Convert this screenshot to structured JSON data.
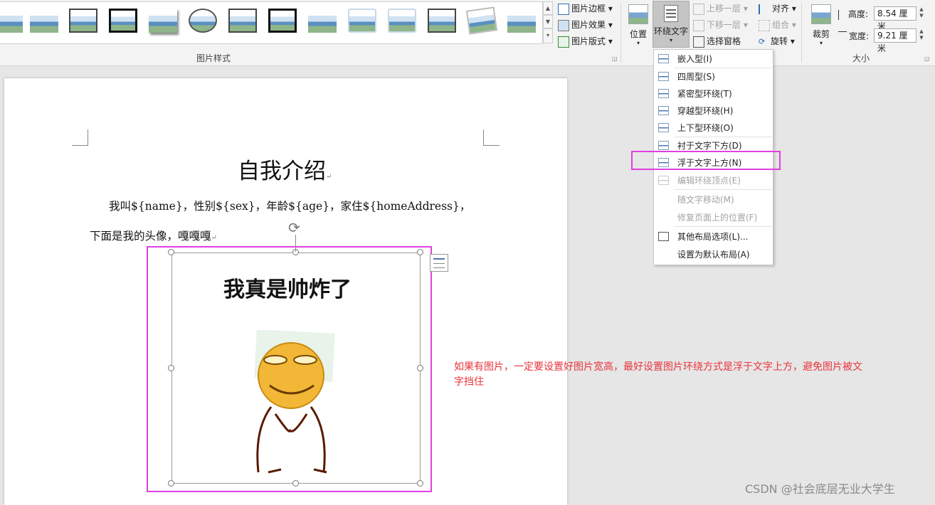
{
  "ribbon": {
    "picture_styles_group": "图片样式",
    "picture_border": "图片边框",
    "picture_effects": "图片效果",
    "picture_layout": "图片版式",
    "position": "位置",
    "wrap_text": "环绕文字",
    "bring_forward": "上移一层",
    "send_backward": "下移一层",
    "selection_pane": "选择窗格",
    "align": "对齐",
    "group": "组合",
    "rotate": "旋转",
    "crop": "裁剪",
    "height_label": "高度:",
    "height_value": "8.54 厘米",
    "width_label": "宽度:",
    "width_value": "9.21 厘米",
    "size_group": "大小"
  },
  "wrap_menu": {
    "items": [
      {
        "label": "嵌入型(I)",
        "enabled": true
      },
      {
        "label": "四周型(S)",
        "enabled": true
      },
      {
        "label": "紧密型环绕(T)",
        "enabled": true
      },
      {
        "label": "穿越型环绕(H)",
        "enabled": true
      },
      {
        "label": "上下型环绕(O)",
        "enabled": true
      },
      {
        "label": "衬于文字下方(D)",
        "enabled": true
      },
      {
        "label": "浮于文字上方(N)",
        "enabled": true
      },
      {
        "label": "编辑环绕顶点(E)",
        "enabled": false
      },
      {
        "label": "随文字移动(M)",
        "enabled": false
      },
      {
        "label": "修复页面上的位置(F)",
        "enabled": false
      },
      {
        "label": "其他布局选项(L)...",
        "enabled": true
      },
      {
        "label": "设置为默认布局(A)",
        "enabled": true
      }
    ]
  },
  "document": {
    "title": "自我介绍",
    "line1": "我叫${name}，性别${sex}，年龄${age}，家住${homeAddress}，",
    "line2": "下面是我的头像，嘎嘎嘎",
    "image_caption": "我真是帅炸了"
  },
  "annotation": {
    "line1": "如果有图片，一定要设置好图片宽高，最好设置图片环绕方式是浮于文字上方，避免图片被文",
    "line2": "字挡住"
  },
  "watermark": "CSDN @社会底层无业大学生",
  "colors": {
    "highlight": "#e040e0",
    "annotation_text": "#e8343b",
    "ribbon_bg": "#f3f3f3"
  }
}
